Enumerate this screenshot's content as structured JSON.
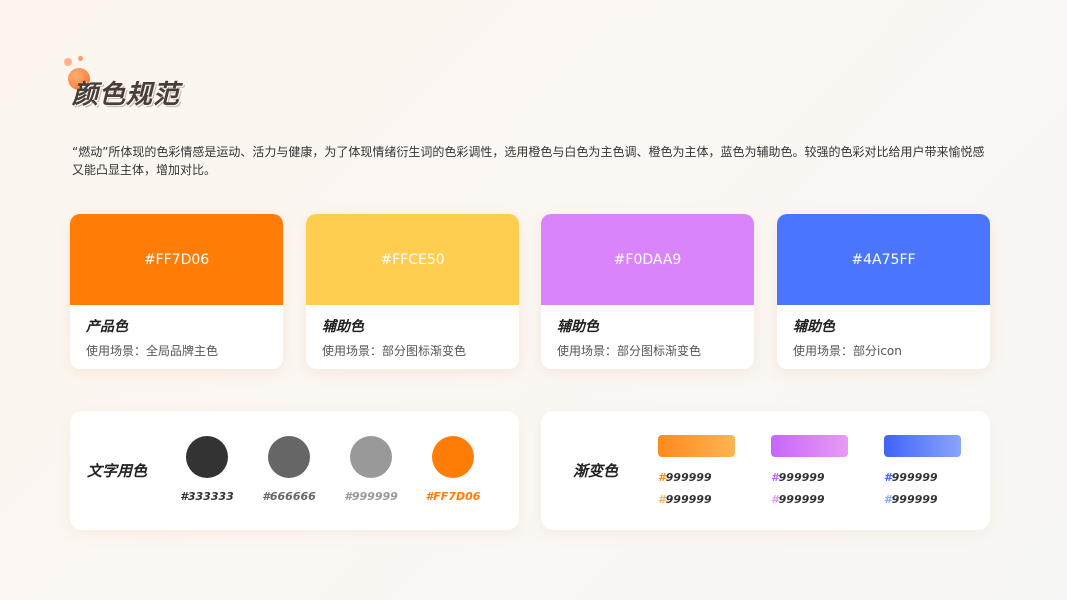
{
  "header": {
    "title": "颜色规范"
  },
  "intro": "“燃动”所体现的色彩情感是运动、活力与健康，为了体现情绪衍生词的色彩调性，选用橙色与白色为主色调、橙色为主体，蓝色为辅助色。较强的色彩对比给用户带来愉悦感又能凸显主体，增加对比。",
  "cards": [
    {
      "hex": "#FF7D06",
      "color": "#FF7D06",
      "name": "产品色",
      "usage": "使用场景：全局品牌主色"
    },
    {
      "hex": "#FFCE50",
      "color": "#FFCE50",
      "name": "辅助色",
      "usage": "使用场景：部分图标渐变色"
    },
    {
      "hex": "#F0DAA9",
      "color": "#D984FB",
      "name": "辅助色",
      "usage": "使用场景：部分图标渐变色"
    },
    {
      "hex": "#4A75FF",
      "color": "#4A75FF",
      "name": "辅助色",
      "usage": "使用场景：部分icon"
    }
  ],
  "text_colors": {
    "title": "文字用色",
    "items": [
      {
        "label": "#333333",
        "color": "#333333"
      },
      {
        "label": "#666666",
        "color": "#666666"
      },
      {
        "label": "#999999",
        "color": "#999999"
      },
      {
        "label": "#FF7D06",
        "color": "#FF7D06"
      }
    ]
  },
  "gradients": {
    "title": "渐变色",
    "items": [
      {
        "from": "#FF8A1E",
        "to": "#FFB452",
        "labels": [
          "#999999",
          "#999999"
        ],
        "hash_colors": [
          "#FF8A1E",
          "#FFB452"
        ]
      },
      {
        "from": "#C866FA",
        "to": "#E79BF5",
        "labels": [
          "#999999",
          "#999999"
        ],
        "hash_colors": [
          "#C866FA",
          "#E79BF5"
        ]
      },
      {
        "from": "#3F64FA",
        "to": "#8AA5FB",
        "labels": [
          "#999999",
          "#999999"
        ],
        "hash_colors": [
          "#3F64FA",
          "#8AA5FB"
        ]
      }
    ]
  }
}
